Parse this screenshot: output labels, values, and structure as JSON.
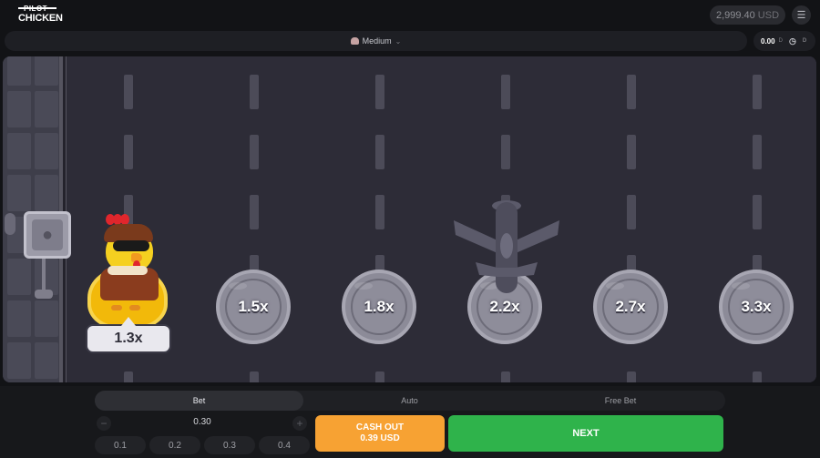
{
  "header": {
    "logo_top": "PILOT",
    "logo_bottom": "CHICKEN",
    "balance_amount": "2,999.40",
    "balance_currency": "USD",
    "menu_icon": "menu-icon"
  },
  "difficulty": {
    "label": "Medium",
    "icon": "chicken-head-icon",
    "chevron": "chevron-down-icon"
  },
  "bet_pill": {
    "value": "0.00",
    "currency": "D",
    "history_icon": "history-icon",
    "currency_suffix": "D"
  },
  "board": {
    "current_multiplier": "1.3x",
    "lanes": [
      {
        "multiplier": "1.5x"
      },
      {
        "multiplier": "1.8x"
      },
      {
        "multiplier": "2.2x"
      },
      {
        "multiplier": "2.7x"
      },
      {
        "multiplier": "3.3x"
      }
    ],
    "hazard": "airplane",
    "sign_icon": "chicken-sign-icon"
  },
  "controls": {
    "tabs": [
      {
        "label": "Bet",
        "active": true
      },
      {
        "label": "Auto",
        "active": false
      },
      {
        "label": "Free Bet",
        "active": false
      }
    ],
    "amount": "0.30",
    "minus": "−",
    "plus": "+",
    "presets": [
      "0.1",
      "0.2",
      "0.3",
      "0.4"
    ],
    "cashout_label": "CASH OUT",
    "cashout_amount": "0.39 USD",
    "next_label": "NEXT"
  },
  "colors": {
    "cashout": "#f7a233",
    "next": "#2fb34b",
    "board": "#2f2e39",
    "gold_coin": "#f2b90a"
  }
}
